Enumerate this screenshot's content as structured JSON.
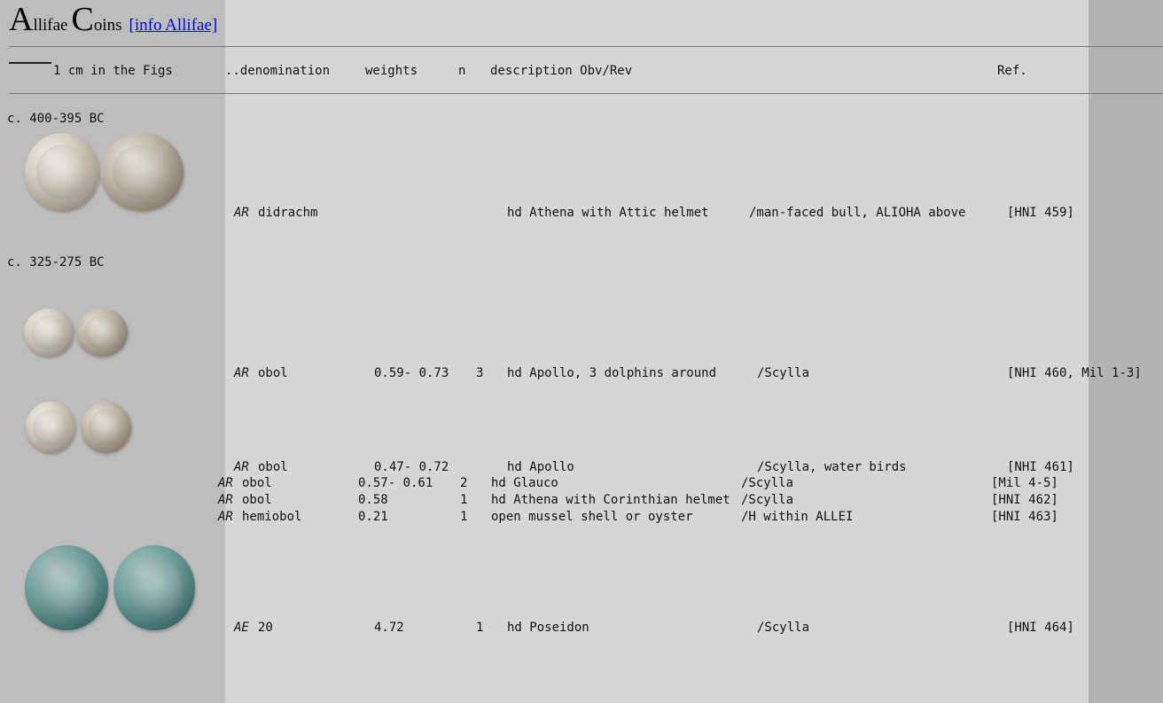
{
  "header": {
    "title_big_a": "A",
    "title_small_a": "llifae",
    "title_big_c": "C",
    "title_small_c": "oins",
    "info_link": "[info Allifae]"
  },
  "columns": {
    "scale": "1 cm in the Figs",
    "denomination": "..denomination",
    "weights": "weights",
    "n": "n",
    "description": "description Obv/Rev",
    "ref": "Ref."
  },
  "sections": [
    {
      "date": "c. 400-395 BC",
      "rows": [
        {
          "metal": "AR",
          "denomination": "didrachm",
          "weights": "",
          "n": "",
          "obverse": "hd Athena with Attic helmet",
          "reverse": "/man-faced bull, ALIOHA above",
          "ref": "[HNI 459]"
        }
      ]
    },
    {
      "date": "c. 325-275 BC",
      "rows": [
        {
          "metal": "AR",
          "denomination": "obol",
          "weights": "0.59- 0.73",
          "n": "3",
          "obverse": "hd Apollo, 3 dolphins around",
          "reverse": "/Scylla",
          "ref": "[NHI 460, Mil 1-3]"
        },
        {
          "metal": "AR",
          "denomination": "obol",
          "weights": "0.47- 0.72",
          "n": "",
          "obverse": "hd Apollo",
          "reverse": "/Scylla, water birds",
          "ref": "[NHI 461]"
        },
        {
          "metal": "AR",
          "denomination": "obol",
          "weights": "0.57- 0.61",
          "n": "2",
          "obverse": "hd Glauco",
          "reverse": "/Scylla",
          "ref": "[Mil 4-5]"
        },
        {
          "metal": "AR",
          "denomination": "obol",
          "weights": "0.58",
          "n": "1",
          "obverse": "hd Athena with Corinthian helmet",
          "reverse": "/Scylla",
          "ref": "[HNI 462]"
        },
        {
          "metal": "AR",
          "denomination": "hemiobol",
          "weights": "0.21",
          "n": "1",
          "obverse": "open mussel shell or oyster",
          "reverse": "/H within ALLEI",
          "ref": "[HNI 463]"
        },
        {
          "metal": "AE",
          "denomination": "20",
          "weights": "4.72",
          "n": "1",
          "obverse": "hd Poseidon",
          "reverse": "/Scylla",
          "ref": "[HNI 464]"
        }
      ]
    }
  ]
}
